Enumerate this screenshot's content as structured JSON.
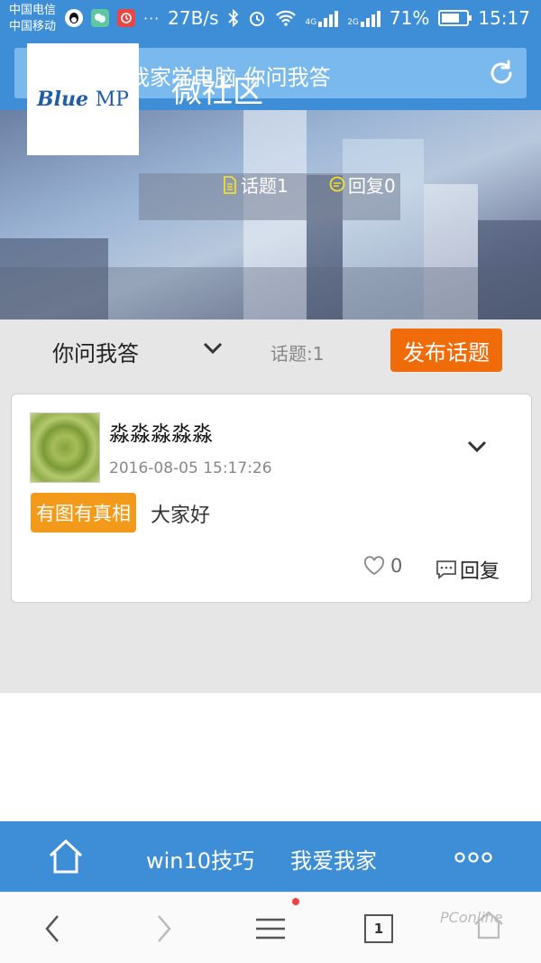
{
  "status_bar": {
    "carrier1": "中国电信",
    "carrier2": "中国移动",
    "app_icons": [
      "qq-icon",
      "wechat-icon",
      "alarm-app-icon"
    ],
    "more": "···",
    "net_speed": "27B/s",
    "net_tag_top": "4G",
    "net_tag_bottom": "2G",
    "battery_text": "71%",
    "battery_level": 0.71,
    "time": "15:17"
  },
  "search": {
    "text": "我爱我家学电脑-你问我答"
  },
  "banner": {
    "logo_main": "Blue",
    "logo_sub": "MP",
    "title": "微社区",
    "topics_label": "话题1",
    "replies_label": "回复0"
  },
  "category": {
    "name": "你问我答",
    "count_label": "话题:1",
    "publish_label": "发布话题"
  },
  "post": {
    "author": "淼淼淼淼淼",
    "timestamp": "2016-08-05 15:17:26",
    "tag": "有图有真相",
    "text": "大家好",
    "likes": "0",
    "reply_label": "回复"
  },
  "bottom_nav": {
    "link1": "win10技巧",
    "link2": "我爱我家",
    "more_icon": "more-icon"
  },
  "toolbar": {
    "tabs_count": "1",
    "watermark": "PConline"
  },
  "colors": {
    "primary": "#3d8ed6",
    "publish": "#f06c0b",
    "tag": "#f39a1b"
  }
}
